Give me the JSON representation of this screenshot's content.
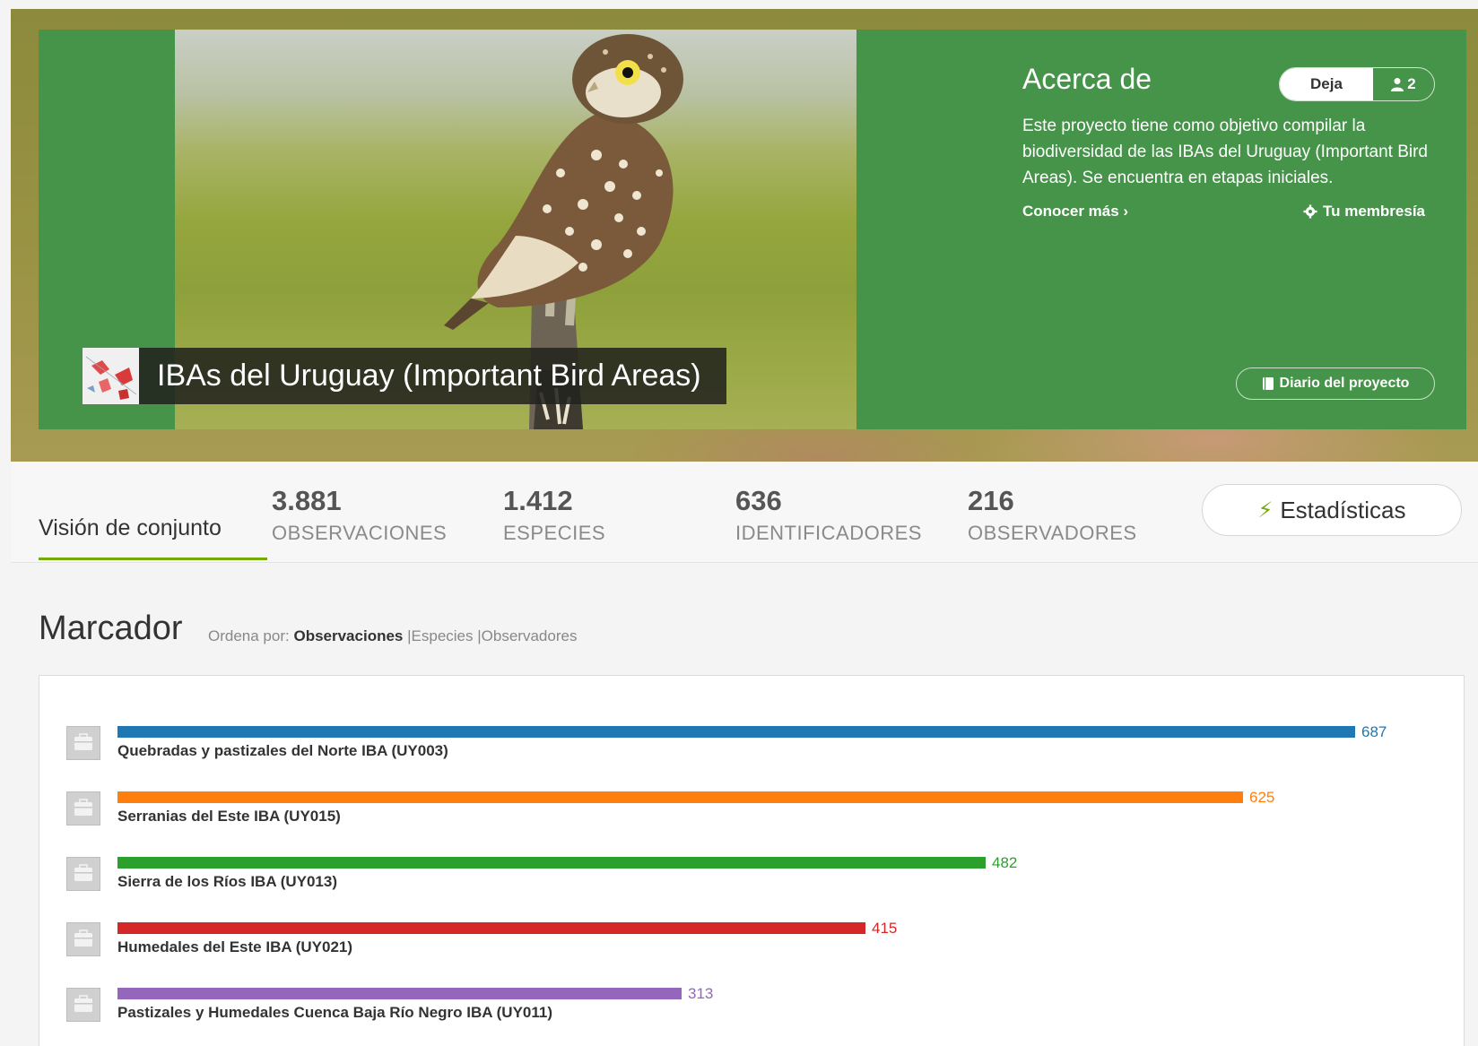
{
  "project": {
    "title": "IBAs del Uruguay (Important Bird Areas)"
  },
  "about": {
    "title": "Acerca de",
    "join_label": "Deja",
    "members_count": "2",
    "description": "Este proyecto tiene como objetivo compilar la biodiversidad de las IBAs del Uruguay (Important Bird Areas). Se encuentra en etapas iniciales.",
    "learn_more": "Conocer más ›",
    "membership": "Tu membresía",
    "journal": "Diario del proyecto"
  },
  "tabs": {
    "overview": "Visión de conjunto",
    "stats_button": "Estadísticas"
  },
  "stats": [
    {
      "value": "3.881",
      "label": "OBSERVACIONES"
    },
    {
      "value": "1.412",
      "label": "ESPECIES"
    },
    {
      "value": "636",
      "label": "IDENTIFICADORES"
    },
    {
      "value": "216",
      "label": "OBSERVADORES"
    }
  ],
  "leaderboard": {
    "title": "Marcador",
    "sort_prefix": "Ordena por:",
    "sort_options": [
      "Observaciones",
      "Especies",
      "Observadores"
    ],
    "max_value": 687,
    "rows": [
      {
        "name": "Quebradas y pastizales del Norte IBA (UY003)",
        "value": 687,
        "color": "#1f77b4"
      },
      {
        "name": "Serranias del Este IBA (UY015)",
        "value": 625,
        "color": "#ff7f0e"
      },
      {
        "name": "Sierra de los Ríos IBA (UY013)",
        "value": 482,
        "color": "#2ca02c"
      },
      {
        "name": "Humedales del Este IBA (UY021)",
        "value": 415,
        "color": "#d62728"
      },
      {
        "name": "Pastizales y Humedales Cuenca Baja Río Negro IBA (UY011)",
        "value": 313,
        "color": "#9467bd"
      }
    ]
  },
  "colors": {
    "banner_green": "#46944a",
    "accent_green": "#74ac00"
  }
}
